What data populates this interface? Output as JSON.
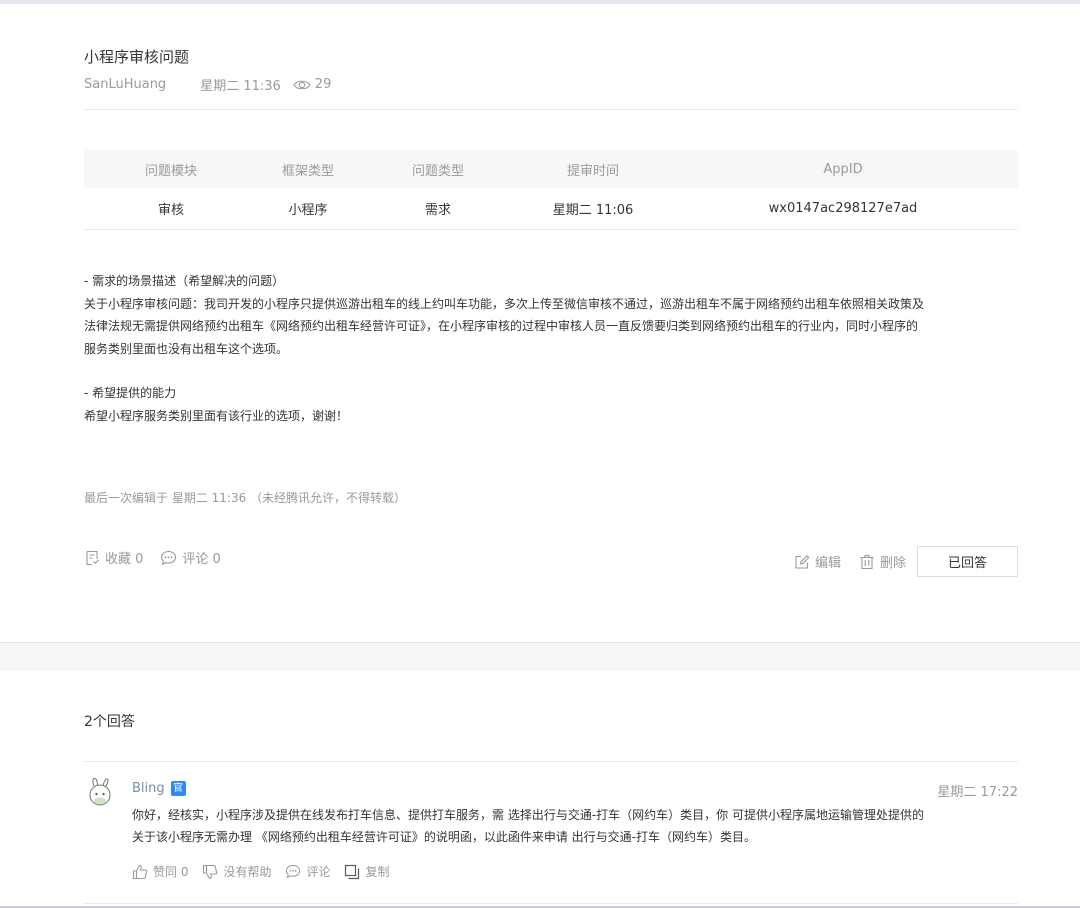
{
  "post": {
    "title": "小程序审核问题",
    "author": "SanLuHuang",
    "time": "星期二 11:36",
    "views": "29"
  },
  "info_table": {
    "headers": [
      "问题模块",
      "框架类型",
      "问题类型",
      "提审时间",
      "AppID"
    ],
    "row": [
      "审核",
      "小程序",
      "需求",
      "星期二 11:06",
      "wx0147ac298127e7ad"
    ]
  },
  "content": {
    "section1_title": "- 需求的场景描述（希望解决的问题）",
    "section1_lines": [
      "关于小程序审核问题：我司开发的小程序只提供巡游出租车的线上约叫车功能，多次上传至微信审核不通过，巡游出租车不属于网络预约出租车依照相关政策及",
      "法律法规无需提供网络预约出租车《网络预约出租车经营许可证》，在小程序审核的过程中审核人员一直反馈要归类到网络预约出租车的行业内，同时小程序的",
      "服务类别里面也没有出租车这个选项。"
    ],
    "section2_title": "- 希望提供的能力",
    "section2_line": "希望小程序服务类别里面有该行业的选项，谢谢！"
  },
  "edit_note": "最后一次编辑于  星期二 11:36  （未经腾讯允许，不得转载）",
  "actions": {
    "favorite": "收藏 0",
    "comment": "评论 0",
    "edit": "编辑",
    "delete": "删除",
    "answered": "已回答"
  },
  "answers": {
    "count_label": "2个回答",
    "items": [
      {
        "user": "Bling",
        "badge": "官",
        "time": "星期二 17:22",
        "lines": [
          "你好，经核实，小程序涉及提供在线发布打车信息、提供打车服务，需 选择出行与交通-打车（网约车）类目，你 可提供小程序属地运输管理处提供的",
          "关于该小程序无需办理 《网络预约出租车经营许可证》的说明函，以此函件来申请 出行与交通-打车（网约车）类目。"
        ],
        "agree": "赞同 0",
        "not_helpful": "没有帮助",
        "comment": "评论",
        "copy": "复制"
      }
    ]
  },
  "colors": {
    "text": "#353535",
    "muted": "#9a9a9a",
    "link_user": "#7a8fa6",
    "badge": "#2f8bf1",
    "table_header_bg": "#f6f7f9",
    "band_bg": "#f5f6f7"
  },
  "icons": [
    "eye-icon",
    "favorite-icon",
    "comment-icon",
    "edit-icon",
    "delete-icon",
    "thumbs-up-icon",
    "thumbs-down-icon",
    "copy-icon",
    "avatar-bunny-icon"
  ]
}
